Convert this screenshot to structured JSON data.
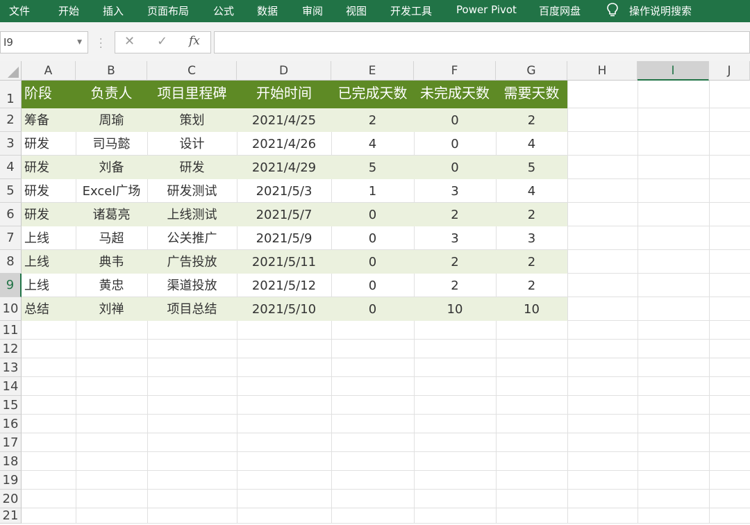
{
  "ribbon": {
    "tabs": [
      "文件",
      "开始",
      "插入",
      "页面布局",
      "公式",
      "数据",
      "审阅",
      "视图",
      "开发工具",
      "Power Pivot",
      "百度网盘"
    ],
    "tell_me": "操作说明搜索",
    "bar_color": "#217346"
  },
  "formula_bar": {
    "name_box": "I9",
    "cancel_symbol": "✕",
    "enter_symbol": "✓",
    "fx_symbol": "fx",
    "formula": ""
  },
  "sheet": {
    "columns": [
      "A",
      "B",
      "C",
      "D",
      "E",
      "F",
      "G",
      "H",
      "I",
      "J"
    ],
    "selected_column": "I",
    "row_numbers": [
      "1",
      "2",
      "3",
      "4",
      "5",
      "6",
      "7",
      "8",
      "9",
      "10",
      "11",
      "12",
      "13",
      "14",
      "15",
      "16",
      "17",
      "18",
      "19",
      "20",
      "21"
    ],
    "selected_row": "9",
    "header_fill": "#5e8a25",
    "band_fill": "#ebf1de",
    "header": [
      "阶段",
      "负责人",
      "项目里程碑",
      "开始时间",
      "已完成天数",
      "未完成天数",
      "需要天数"
    ],
    "rows": [
      [
        "筹备",
        "周瑜",
        "策划",
        "2021/4/25",
        "2",
        "0",
        "2"
      ],
      [
        "研发",
        "司马懿",
        "设计",
        "2021/4/26",
        "4",
        "0",
        "4"
      ],
      [
        "研发",
        "刘备",
        "研发",
        "2021/4/29",
        "5",
        "0",
        "5"
      ],
      [
        "研发",
        "Excel广场",
        "研发测试",
        "2021/5/3",
        "1",
        "3",
        "4"
      ],
      [
        "研发",
        "诸葛亮",
        "上线测试",
        "2021/5/7",
        "0",
        "2",
        "2"
      ],
      [
        "上线",
        "马超",
        "公关推广",
        "2021/5/9",
        "0",
        "3",
        "3"
      ],
      [
        "上线",
        "典韦",
        "广告投放",
        "2021/5/11",
        "0",
        "2",
        "2"
      ],
      [
        "上线",
        "黄忠",
        "渠道投放",
        "2021/5/12",
        "0",
        "2",
        "2"
      ],
      [
        "总结",
        "刘禅",
        "项目总结",
        "2021/5/10",
        "0",
        "10",
        "10"
      ]
    ]
  }
}
